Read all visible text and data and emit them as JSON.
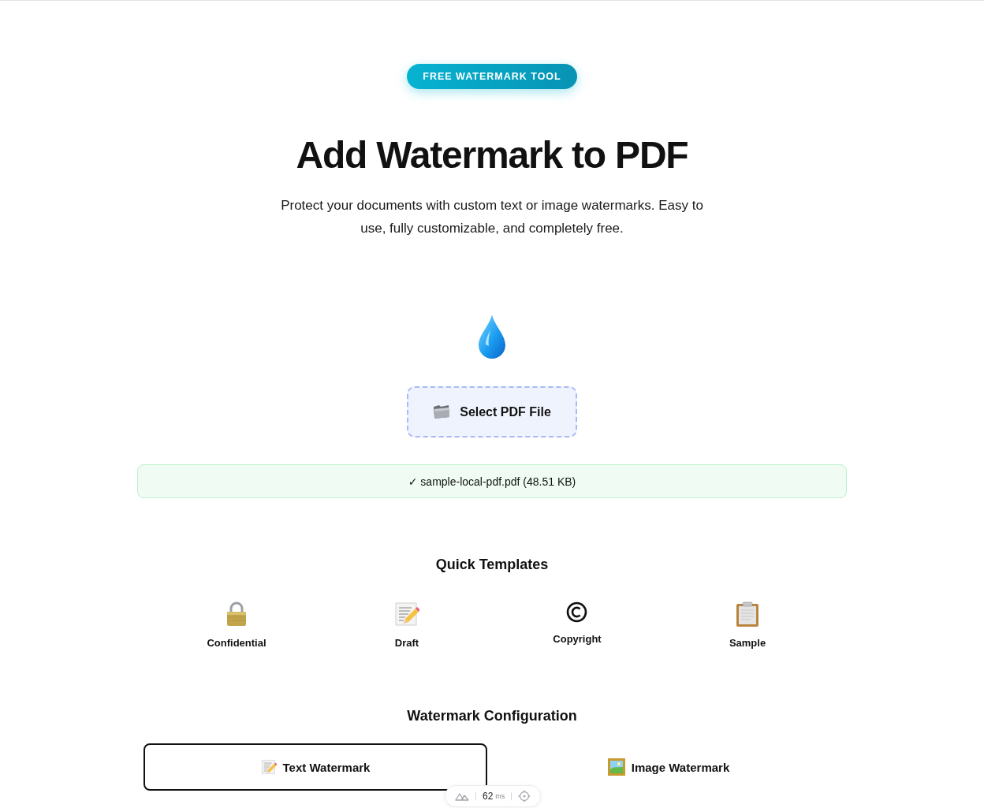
{
  "badge": "FREE WATERMARK TOOL",
  "title": "Add Watermark to PDF",
  "subtitle": "Protect your documents with custom text or image watermarks. Easy to use, fully customizable, and completely free.",
  "upload": {
    "button": "Select PDF File",
    "status": "✓ sample-local-pdf.pdf (48.51 KB)"
  },
  "templates": {
    "title": "Quick Templates",
    "items": [
      {
        "label": "Confidential"
      },
      {
        "label": "Draft"
      },
      {
        "label": "Copyright"
      },
      {
        "label": "Sample"
      }
    ]
  },
  "configuration": {
    "title": "Watermark Configuration",
    "tabs": [
      {
        "label": "Text Watermark",
        "selected": true
      },
      {
        "label": "Image Watermark",
        "selected": false
      }
    ]
  },
  "devtools": {
    "time": "62",
    "unit": "ms"
  }
}
